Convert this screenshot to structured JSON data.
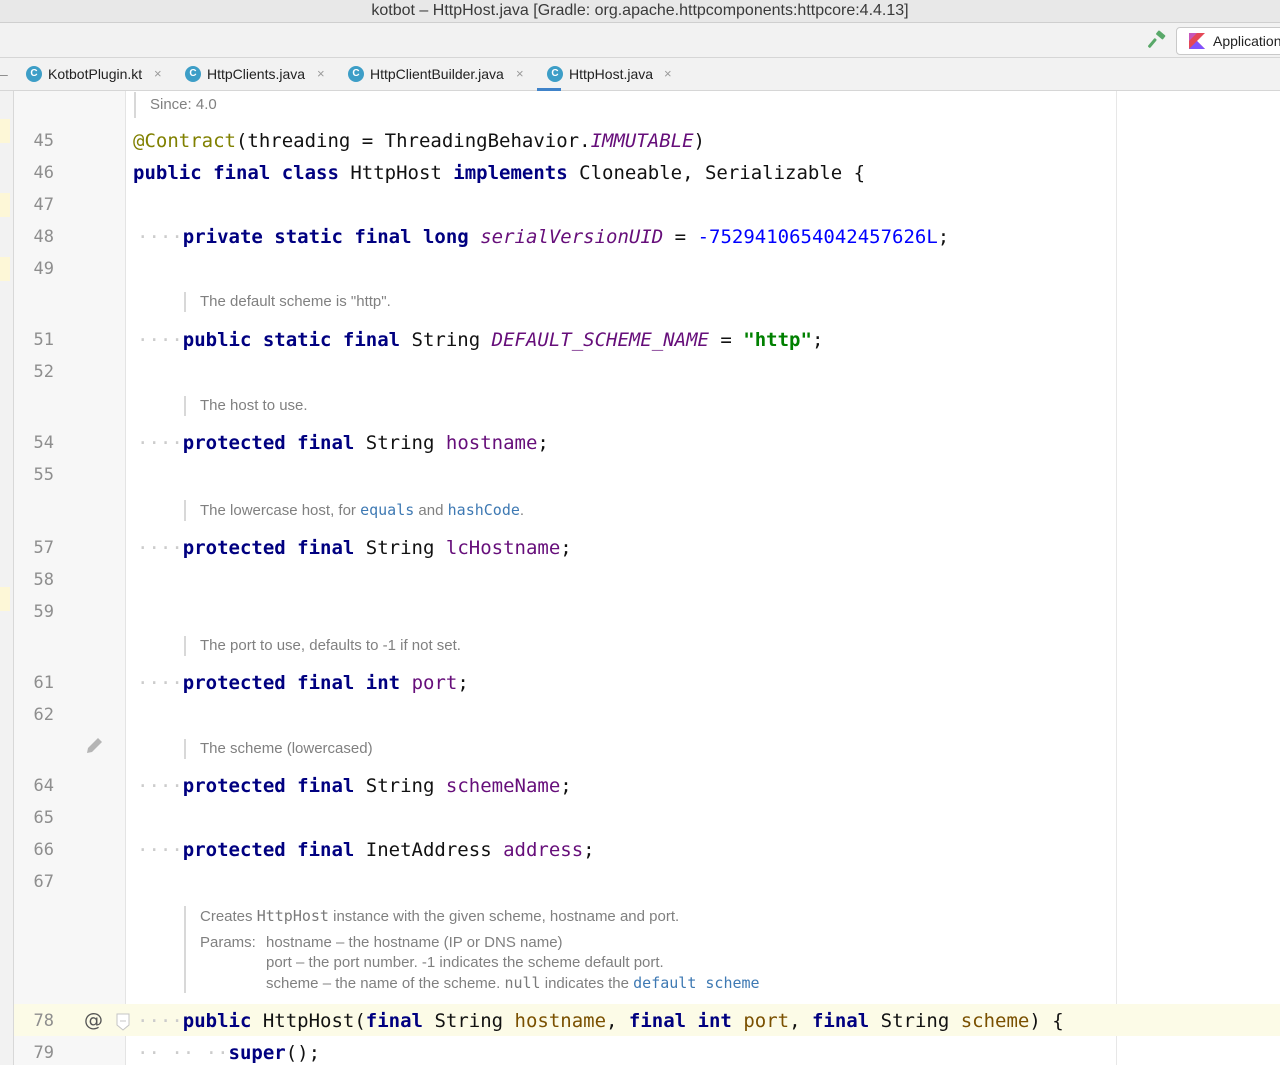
{
  "window": {
    "title": "kotbot – HttpHost.java [Gradle: org.apache.httpcomponents:httpcore:4.4.13]"
  },
  "toolbar": {
    "build_icon": "hammer-icon",
    "run_config_label": "Application"
  },
  "tabs": [
    {
      "label": "KotbotPlugin.kt",
      "icon": "kotlin-class-icon",
      "active": false
    },
    {
      "label": "HttpClients.java",
      "icon": "java-class-icon",
      "active": false
    },
    {
      "label": "HttpClientBuilder.java",
      "icon": "java-class-icon",
      "active": false
    },
    {
      "label": "HttpHost.java",
      "icon": "java-class-icon",
      "active": true
    }
  ],
  "tab_close_glyph": "×",
  "editor": {
    "since_doc": "Since: 4.0",
    "line_numbers": [
      "45",
      "46",
      "47",
      "48",
      "49",
      "51",
      "52",
      "54",
      "55",
      "57",
      "58",
      "59",
      "61",
      "62",
      "64",
      "65",
      "66",
      "67",
      "78",
      "79"
    ],
    "docs": {
      "default_scheme": "The default scheme is \"http\".",
      "host": "The host to use.",
      "lc_host_pre": "The lowercase host, for ",
      "lc_host_equals": "equals",
      "lc_host_and": " and ",
      "lc_host_hashcode": "hashCode",
      "lc_host_post": ".",
      "port": "The port to use, defaults to -1 if not set.",
      "scheme": "The scheme (lowercased)",
      "ctor_pre": "Creates ",
      "ctor_class": "HttpHost",
      "ctor_post": " instance with the given scheme, hostname and port.",
      "params_label": "Params:",
      "param_hostname": "hostname – the hostname (IP or DNS name)",
      "param_port": "port – the port number. -1 indicates the scheme default port.",
      "param_scheme_pre": "scheme – the name of the scheme. ",
      "param_scheme_null": "null",
      "param_scheme_mid": " indicates the ",
      "param_scheme_link": "default scheme"
    },
    "code": {
      "l45_ann": "@Contract",
      "l45_a": "(threading = ThreadingBehavior.",
      "l45_b": "IMMUTABLE",
      "l45_c": ")",
      "l46_kw1": "public final class",
      "l46_a": " HttpHost ",
      "l46_kw2": "implements",
      "l46_b": " Cloneable, Serializable {",
      "l48_kw": "private static final long",
      "l48_field": "serialVersionUID",
      "l48_eq": " = ",
      "l48_num": "-7529410654042457626L",
      "l48_end": ";",
      "l51_kw": "public static final",
      "l51_type": " String ",
      "l51_field": "DEFAULT_SCHEME_NAME",
      "l51_eq": " = ",
      "l51_str": "\"http\"",
      "l51_end": ";",
      "l54_kw": "protected final",
      "l54_type": " String ",
      "l54_field": "hostname",
      "l54_end": ";",
      "l57_kw": "protected final",
      "l57_type": " String ",
      "l57_field": "lcHostname",
      "l57_end": ";",
      "l61_kw": "protected final int",
      "l61_field": "port",
      "l61_end": ";",
      "l64_kw": "protected final",
      "l64_type": " String ",
      "l64_field": "schemeName",
      "l64_end": ";",
      "l66_kw": "protected final",
      "l66_type": " InetAddress ",
      "l66_field": "address",
      "l66_end": ";",
      "l78_kw1": "public",
      "l78_a": " HttpHost(",
      "l78_kw2": "final",
      "l78_t1": " String ",
      "l78_p1": "hostname",
      "l78_c1": ", ",
      "l78_kw3": "final int",
      "l78_p2": "port",
      "l78_c2": ", ",
      "l78_kw4": "final",
      "l78_t3": " String ",
      "l78_p3": "scheme",
      "l78_end": ") {",
      "l79_kw": "super",
      "l79_end": "();"
    },
    "gutter_icons": {
      "edit": "pencil-icon",
      "annotation": "at-sign-icon",
      "annotation_glyph": "@",
      "bookmark": "fold-marker-icon"
    },
    "colors": {
      "keyword": "#000080",
      "field": "#660e7a",
      "string": "#008000",
      "number": "#0000ff",
      "annotation": "#808000",
      "link": "#3e79b3"
    }
  }
}
